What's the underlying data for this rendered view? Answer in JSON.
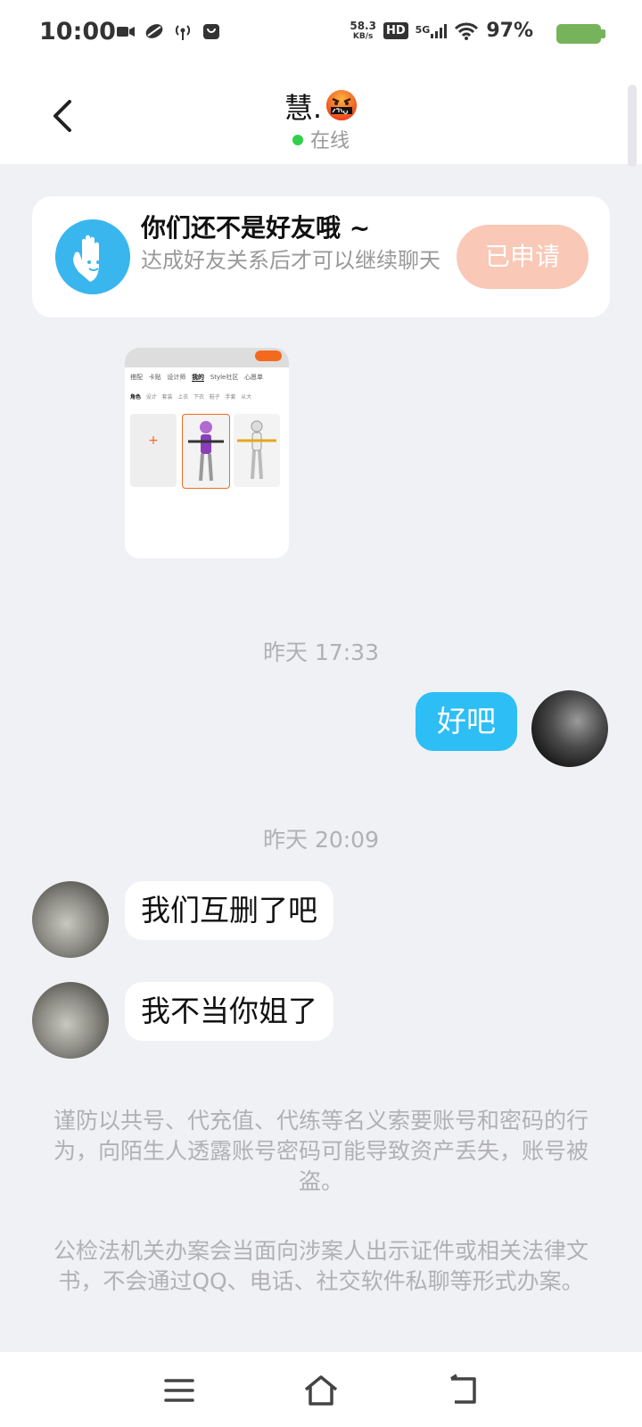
{
  "status_bar": {
    "time": "10:00",
    "net_speed_value": "58.3",
    "net_speed_unit": "KB/s",
    "hd_badge": "HD",
    "network": "5G",
    "battery": "97%"
  },
  "header": {
    "title": "慧.",
    "online_text": "在线"
  },
  "friend_banner": {
    "title": "你们还不是好友哦 ~",
    "subtitle": "达成好友关系后才可以继续聊天",
    "button_label": "已申请"
  },
  "image_message": {
    "tabs": [
      "搭配",
      "卡贴",
      "设计师",
      "我的",
      "Style社区",
      "心愿单"
    ],
    "subtabs": [
      "角色",
      "设计",
      "套装",
      "上衣",
      "下衣",
      "鞋子",
      "手套",
      "从大"
    ]
  },
  "messages": {
    "time_1": "昨天 17:33",
    "out_1": "好吧",
    "time_2": "昨天 20:09",
    "in_1": "我们互删了吧",
    "in_2": "我不当你姐了"
  },
  "notices": {
    "notice_1": "谨防以共号、代充值、代练等名义索要账号和密码的行为，向陌生人透露账号密码可能导致资产丢失，账号被盗。",
    "notice_2": "公检法机关办案会当面向涉案人出示证件或相关法律文书，不会通过QQ、电话、社交软件私聊等形式办案。"
  },
  "colors": {
    "accent_blue": "#2dbef5",
    "online_green": "#2fd14a",
    "applied_button": "#f9c8b6",
    "background": "#f0f1f5"
  },
  "icons": [
    "back-icon",
    "angry-emoji-icon",
    "hand-wave-icon",
    "menu-icon",
    "home-icon",
    "back-nav-icon"
  ]
}
